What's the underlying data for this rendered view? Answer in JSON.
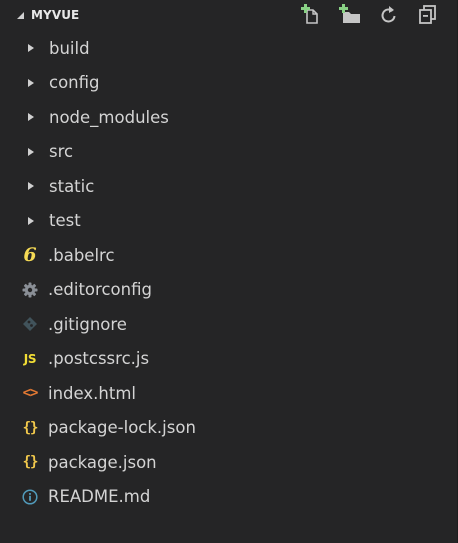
{
  "explorer": {
    "title": "MYVUE",
    "actions": [
      {
        "name": "new-file-icon"
      },
      {
        "name": "new-folder-icon"
      },
      {
        "name": "refresh-icon"
      },
      {
        "name": "collapse-all-icon"
      }
    ]
  },
  "tree": {
    "folders": [
      {
        "label": "build"
      },
      {
        "label": "config"
      },
      {
        "label": "node_modules"
      },
      {
        "label": "src"
      },
      {
        "label": "static"
      },
      {
        "label": "test"
      }
    ],
    "files": [
      {
        "label": ".babelrc",
        "icon": "babel-icon",
        "color": "#f5da55"
      },
      {
        "label": ".editorconfig",
        "icon": "gear-icon",
        "color": "#8a8f96"
      },
      {
        "label": ".gitignore",
        "icon": "git-icon",
        "color": "#41535b"
      },
      {
        "label": ".postcssrc.js",
        "icon": "javascript-icon",
        "color": "#f1dd35"
      },
      {
        "label": "index.html",
        "icon": "html-icon",
        "color": "#e37933"
      },
      {
        "label": "package-lock.json",
        "icon": "json-icon",
        "color": "#f2c94c"
      },
      {
        "label": "package.json",
        "icon": "json-icon",
        "color": "#f2c94c"
      },
      {
        "label": "README.md",
        "icon": "info-icon",
        "color": "#519aba"
      }
    ]
  }
}
